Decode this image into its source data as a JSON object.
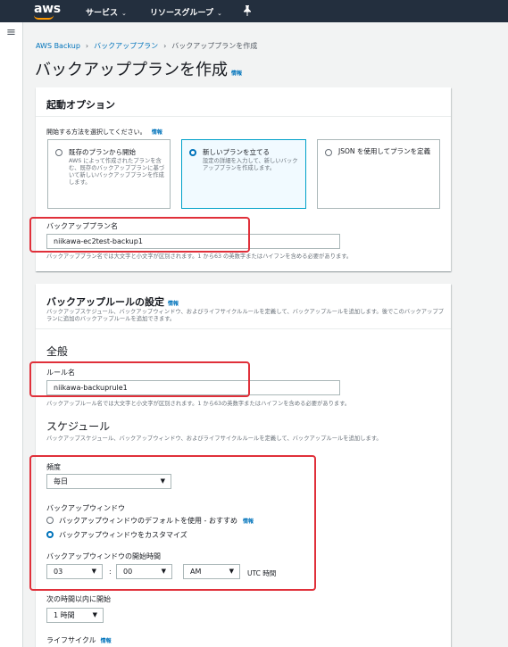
{
  "header": {
    "logo": "aws",
    "services": "サービス",
    "resource_groups": "リソースグループ",
    "pin_icon": "pushpin-icon"
  },
  "breadcrumbs": {
    "root": "AWS Backup",
    "plans": "バックアッププラン",
    "current": "バックアッププランを作成"
  },
  "page": {
    "title": "バックアッププランを作成",
    "info": "情報"
  },
  "startup": {
    "title": "起動オプション",
    "prompt": "開始する方法を選択してください。",
    "info": "情報",
    "options": [
      {
        "title": "既存のプランから開始",
        "desc": "AWS によって作成されたプランを含む、既存のバックアッププランに基づいて新しいバックアッププランを作成します。",
        "selected": false
      },
      {
        "title": "新しいプランを立てる",
        "desc": "設定の詳細を入力して、新しいバックアッププランを作成します。",
        "selected": true
      },
      {
        "title": "JSON を使用してプランを定義",
        "desc": "",
        "selected": false
      }
    ],
    "plan_name_label": "バックアッププラン名",
    "plan_name_value": "niikawa-ec2test-backup1",
    "plan_name_hint": "バックアッププラン名では大文字と小文字が区別されます。1 から63 の英数字またはハイフンを含める必要があります。"
  },
  "rule": {
    "title": "バックアップルールの設定",
    "info": "情報",
    "desc": "バックアップスケジュール、バックアップウィンドウ、およびライフサイクルルールを定義して、バックアップルールを追加します。後でこのバックアッププランに追加のバックアップルールを追加できます。",
    "general_title": "全般",
    "rule_name_label": "ルール名",
    "rule_name_value": "niikawa-backuprule1",
    "rule_name_hint": "バックアップルール名では大文字と小文字が区別されます。1 から63の英数字またはハイフンを含める必要があります。",
    "schedule_title": "スケジュール",
    "schedule_desc": "バックアップスケジュール、バックアップウィンドウ、およびライフサイクルルールを定義して、バックアップルールを追加します。",
    "frequency_label": "頻度",
    "frequency_value": "毎日",
    "window_label": "バックアップウィンドウ",
    "window_default": "バックアップウィンドウのデフォルトを使用 - おすすめ",
    "window_default_info": "情報",
    "window_custom": "バックアップウィンドウをカスタマイズ",
    "start_time_label": "バックアップウィンドウの開始時間",
    "hour": "03",
    "colon": ":",
    "minute": "00",
    "ampm": "AM",
    "utc": "UTC 時間",
    "start_within_label": "次の時間以内に開始",
    "start_within_value": "1 時間",
    "lifecycle_label": "ライフサイクル",
    "lifecycle_info": "情報"
  }
}
